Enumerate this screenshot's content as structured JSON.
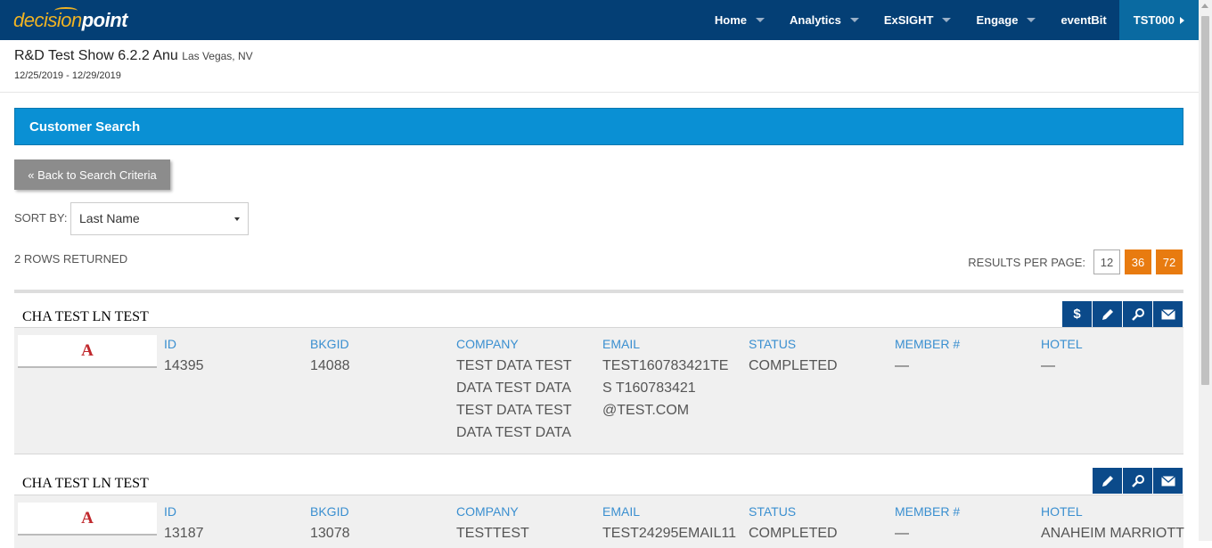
{
  "nav": {
    "logo_part1": "decision",
    "logo_part2": "point",
    "items": [
      {
        "label": "Home",
        "caret": true
      },
      {
        "label": "Analytics",
        "caret": true
      },
      {
        "label": "ExSIGHT",
        "caret": true
      },
      {
        "label": "Engage",
        "caret": true
      },
      {
        "label": "eventBit",
        "caret": false
      }
    ],
    "account": "TST000"
  },
  "show": {
    "title": "R&D Test Show 6.2.2 Anu",
    "location": "Las Vegas, NV",
    "dates": "12/25/2019 - 12/29/2019"
  },
  "panel": {
    "title": "Customer Search",
    "back_label": "« Back to Search Criteria",
    "sort_label": "SORT BY:",
    "sort_value": "Last Name",
    "rows_returned": "2 ROWS RETURNED",
    "rpp_label": "RESULTS PER PAGE:",
    "rpp_options": [
      "12",
      "36",
      "72"
    ],
    "rpp_selected": "12"
  },
  "columns": [
    "ID",
    "BKGID",
    "COMPANY",
    "EMAIL",
    "STATUS",
    "MEMBER #",
    "HOTEL"
  ],
  "records": [
    {
      "name": "CHA TEST LN TEST",
      "badge": "A",
      "id": "14395",
      "bkgid": "14088",
      "company": "TEST DATA TEST DATA TEST DATA TEST DATA TEST DATA TEST DATA",
      "email": "TEST160783421TES T160783421 @TEST.COM",
      "status": "COMPLETED",
      "member": "—",
      "hotel": "—",
      "actions": [
        "dollar-icon",
        "pencil-icon",
        "search-icon",
        "envelope-icon"
      ]
    },
    {
      "name": "CHA TEST LN TEST",
      "badge": "A",
      "id": "13187",
      "bkgid": "13078",
      "company": "TESTTEST",
      "email": "TEST24295EMAIL11",
      "status": "COMPLETED",
      "member": "—",
      "hotel": "ANAHEIM MARRIOTT",
      "actions": [
        "pencil-icon",
        "search-icon",
        "envelope-icon"
      ]
    }
  ],
  "colors": {
    "nav_bg": "#043f75",
    "nav_active": "#0a6aa1",
    "panel_header": "#0a90d4",
    "accent_orange": "#e87b10",
    "action_btn": "#0b4a8a",
    "column_head": "#3a8fd0"
  }
}
